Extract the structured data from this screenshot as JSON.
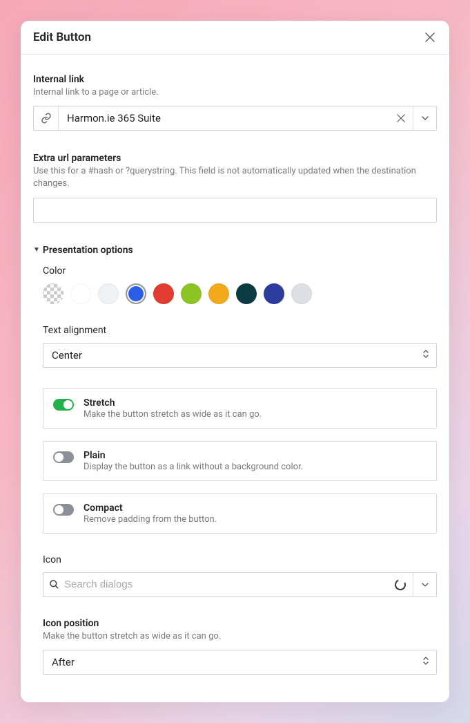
{
  "dialog": {
    "title": "Edit Button"
  },
  "internalLink": {
    "label": "Internal link",
    "desc": "Internal link to a page or article.",
    "value": "Harmon.ie 365 Suite"
  },
  "extraUrl": {
    "label": "Extra url parameters",
    "desc": "Use this for a #hash or ?querystring. This field is not automatically updated when the destination changes.",
    "value": ""
  },
  "presentation": {
    "sectionLabel": "Presentation options",
    "colorLabel": "Color",
    "colors": [
      {
        "name": "none",
        "value": "checker",
        "selected": false
      },
      {
        "name": "white",
        "value": "#ffffff",
        "selected": false
      },
      {
        "name": "lightgray",
        "value": "#eef2f5",
        "selected": false
      },
      {
        "name": "blue",
        "value": "#2b5ee6",
        "selected": true
      },
      {
        "name": "red",
        "value": "#e03c31",
        "selected": false
      },
      {
        "name": "lime",
        "value": "#8cc424",
        "selected": false
      },
      {
        "name": "amber",
        "value": "#f2a91c",
        "selected": false
      },
      {
        "name": "teal",
        "value": "#0d3b44",
        "selected": false
      },
      {
        "name": "navy",
        "value": "#2c3d9e",
        "selected": false
      },
      {
        "name": "silver",
        "value": "#dcdfe3",
        "selected": false
      }
    ],
    "textAlign": {
      "label": "Text alignment",
      "value": "Center"
    },
    "stretch": {
      "title": "Stretch",
      "desc": "Make the button stretch as wide as it can go.",
      "on": true
    },
    "plain": {
      "title": "Plain",
      "desc": "Display the button as a link without a background color.",
      "on": false
    },
    "compact": {
      "title": "Compact",
      "desc": "Remove padding from the button.",
      "on": false
    },
    "icon": {
      "label": "Icon",
      "placeholder": "Search dialogs"
    },
    "iconPosition": {
      "label": "Icon position",
      "desc": "Make the button stretch as wide as it can go.",
      "value": "After"
    }
  }
}
